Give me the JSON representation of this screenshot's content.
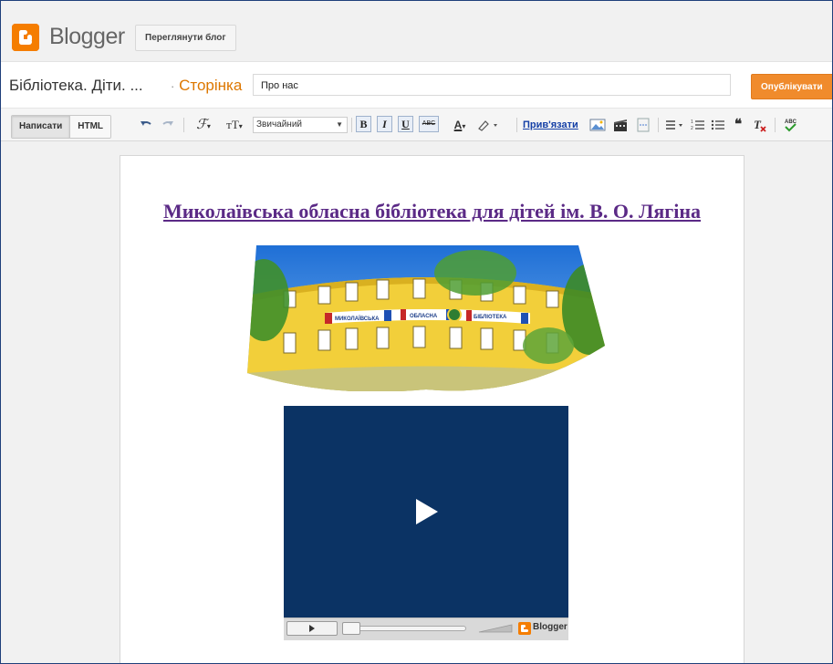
{
  "header": {
    "logo_text": "Blogger",
    "view_blog_label": "Переглянути блог"
  },
  "titlebar": {
    "blog_name": "Бібліотека. Діти. ...",
    "page_type": "Сторінка",
    "page_title_value": "Про нас",
    "publish_label": "Опублікувати"
  },
  "toolbar": {
    "compose_label": "Написати",
    "html_label": "HTML",
    "format_value": "Звичайний",
    "bold": "B",
    "italic": "I",
    "underline": "U",
    "strikethrough": "ABC",
    "link_label": "Прив'язати"
  },
  "content": {
    "heading": "Миколаївська обласна бібліотека для дітей ім. В. О. Лягіна",
    "photo_sign_left": "МИКОЛАЇВСЬКА",
    "photo_sign_mid": "ОБЛАСНА",
    "photo_sign_right": "БІБЛІОТЕКА",
    "video_logo_text": "Blogger"
  },
  "colors": {
    "brand_orange": "#f57d00",
    "heading_purple": "#5b2a86",
    "video_bg": "#0b3364",
    "link_blue": "#1540a6"
  }
}
